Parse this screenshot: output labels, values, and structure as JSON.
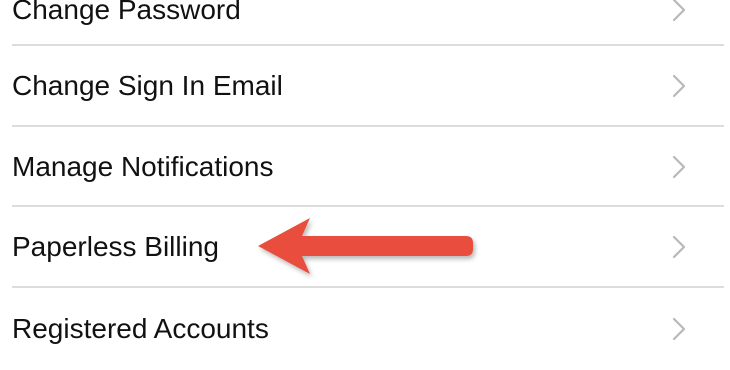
{
  "settings": {
    "items": [
      {
        "label": "Change Password",
        "icon": "chevron-right-icon"
      },
      {
        "label": "Change Sign In Email",
        "icon": "chevron-right-icon"
      },
      {
        "label": "Manage Notifications",
        "icon": "chevron-right-icon"
      },
      {
        "label": "Paperless Billing",
        "icon": "chevron-right-icon"
      },
      {
        "label": "Registered Accounts",
        "icon": "chevron-right-icon"
      }
    ]
  },
  "annotation": {
    "arrow_color": "#e84e3c",
    "target": "Paperless Billing"
  },
  "colors": {
    "text": "#111111",
    "divider": "#dcdcdc",
    "chevron": "#b8b8b8",
    "background": "#ffffff"
  }
}
